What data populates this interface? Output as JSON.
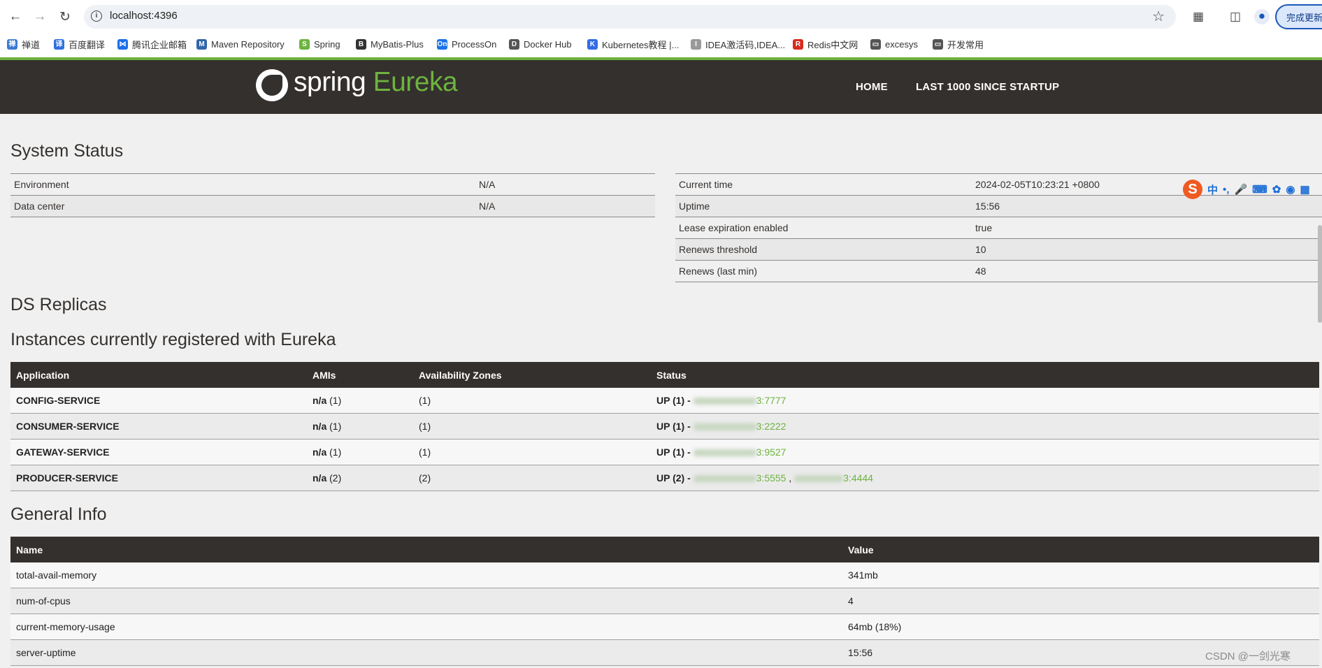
{
  "browser": {
    "url": "localhost:4396",
    "update_label": "完成更新",
    "bookmarks": [
      {
        "label": "禅道",
        "color": "#3a7bd5",
        "glyph": "禅"
      },
      {
        "label": "百度翻译",
        "color": "#2f6fe0",
        "glyph": "译"
      },
      {
        "label": "腾讯企业邮箱",
        "color": "#1d6fe8",
        "glyph": "⋈"
      },
      {
        "label": "Maven Repository",
        "color": "#3366aa",
        "glyph": "M"
      },
      {
        "label": "Spring",
        "color": "#6db33f",
        "glyph": "S"
      },
      {
        "label": "MyBatis-Plus",
        "color": "#333333",
        "glyph": "B"
      },
      {
        "label": "ProcessOn",
        "color": "#1a73e8",
        "glyph": "On"
      },
      {
        "label": "Docker Hub",
        "color": "#555555",
        "glyph": "D"
      },
      {
        "label": "Kubernetes教程 |...",
        "color": "#326ce5",
        "glyph": "K"
      },
      {
        "label": "IDEA激活码,IDEA...",
        "color": "#999999",
        "glyph": "I"
      },
      {
        "label": "Redis中文网",
        "color": "#d82c20",
        "glyph": "R"
      },
      {
        "label": "excesys",
        "color": "#555555",
        "glyph": "▭"
      },
      {
        "label": "开发常用",
        "color": "#555555",
        "glyph": "▭"
      }
    ]
  },
  "header": {
    "logo_spring": "spring",
    "logo_eureka": "Eureka",
    "nav": [
      "HOME",
      "LAST 1000 SINCE STARTUP"
    ]
  },
  "system_status": {
    "title": "System Status",
    "left": [
      {
        "key": "Environment",
        "value": "N/A"
      },
      {
        "key": "Data center",
        "value": "N/A"
      }
    ],
    "right": [
      {
        "key": "Current time",
        "value": "2024-02-05T10:23:21 +0800"
      },
      {
        "key": "Uptime",
        "value": "15:56"
      },
      {
        "key": "Lease expiration enabled",
        "value": "true"
      },
      {
        "key": "Renews threshold",
        "value": "10"
      },
      {
        "key": "Renews (last min)",
        "value": "48"
      }
    ]
  },
  "ds_replicas": {
    "title": "DS Replicas"
  },
  "instances": {
    "title": "Instances currently registered with Eureka",
    "headers": [
      "Application",
      "AMIs",
      "Availability Zones",
      "Status"
    ],
    "rows": [
      {
        "app": "CONFIG-SERVICE",
        "ami": "n/a",
        "ami_count": "(1)",
        "zones": "(1)",
        "status": "UP (1) -",
        "links": [
          "3:7777"
        ]
      },
      {
        "app": "CONSUMER-SERVICE",
        "ami": "n/a",
        "ami_count": "(1)",
        "zones": "(1)",
        "status": "UP (1) -",
        "links": [
          "3:2222"
        ]
      },
      {
        "app": "GATEWAY-SERVICE",
        "ami": "n/a",
        "ami_count": "(1)",
        "zones": "(1)",
        "status": "UP (1) -",
        "links": [
          "3:9527"
        ]
      },
      {
        "app": "PRODUCER-SERVICE",
        "ami": "n/a",
        "ami_count": "(2)",
        "zones": "(2)",
        "status": "UP (2) -",
        "links": [
          "3:5555",
          "3:4444"
        ]
      }
    ]
  },
  "general_info": {
    "title": "General Info",
    "headers": [
      "Name",
      "Value"
    ],
    "rows": [
      {
        "name": "total-avail-memory",
        "value": "341mb"
      },
      {
        "name": "num-of-cpus",
        "value": "4"
      },
      {
        "name": "current-memory-usage",
        "value": "64mb (18%)"
      },
      {
        "name": "server-uptime",
        "value": "15:56"
      }
    ]
  },
  "overlay": {
    "ime_logo": "S",
    "ime_mode": "中",
    "watermark": "CSDN @一剑光寒"
  }
}
